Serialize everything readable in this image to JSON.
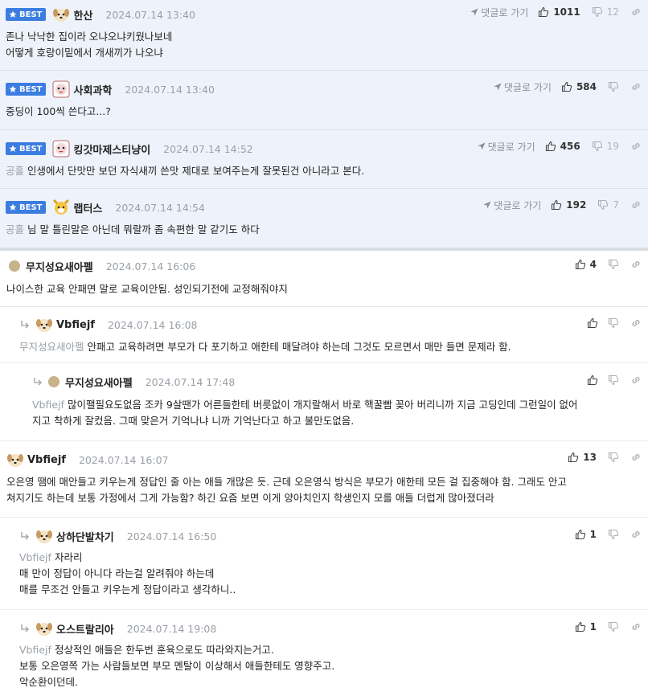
{
  "labels": {
    "best": "BEST",
    "goto": "댓글로 가기"
  },
  "comments": [
    {
      "kind": "best",
      "nick": "한산",
      "date": "2024.07.14 13:40",
      "up": "1011",
      "down": "12",
      "lines": [
        "존나 낙낙한 집이라 오냐오냐키웠나보네",
        "어떻게 호랑이밑에서 개새끼가 나오냐"
      ],
      "mention": ""
    },
    {
      "kind": "best",
      "nick": "사회과학",
      "date": "2024.07.14 13:40",
      "up": "584",
      "down": "",
      "lines": [
        "중딩이 100씩 쓴다고...?"
      ],
      "mention": ""
    },
    {
      "kind": "best",
      "nick": "킹갓마제스티냥이",
      "date": "2024.07.14 14:52",
      "up": "456",
      "down": "19",
      "lines": [
        "인생에서 단맛만 보던 자식새끼 쓴맛 제대로 보여주는게 잘못된건 아니라고 본다."
      ],
      "mention": "공홀"
    },
    {
      "kind": "best",
      "nick": "랩터스",
      "date": "2024.07.14 14:54",
      "up": "192",
      "down": "7",
      "lines": [
        "님 말 틀린말은 아닌데 뭐랄까 좀 속편한 말 같기도 하다"
      ],
      "mention": "공홀"
    },
    {
      "kind": "normal",
      "nick": "무지성요새아펠",
      "date": "2024.07.14 16:06",
      "up": "4",
      "down": "",
      "lines": [
        "나이스한 교육 안패면 말로 교육이안됨. 성인되기전에 교정해줘야지"
      ],
      "mention": ""
    },
    {
      "kind": "reply",
      "nick": "Vbfiejf",
      "date": "2024.07.14 16:08",
      "up": "",
      "down": "",
      "lines": [
        "안패고 교육하려면 부모가 다 포기하고 애한테 매달려야 하는데 그것도 모르면서 매만 들면 문제라 함."
      ],
      "mention": "무지성요새아펠"
    },
    {
      "kind": "reply",
      "nick": "무지성요새아펠",
      "date": "2024.07.14 17:48",
      "up": "",
      "down": "",
      "lines": [
        "많이팰필요도없음 조카 9살땐가 어른들한테 버릇없이 개지랄해서 바로 핵꿀빰 꽂아 버리니까 지금 고딩인데 그런일이 없어",
        "지고 착하게 잘컸음. 그때 맞은거 기억나냐 니까 기억난다고 하고 불만도없음."
      ],
      "mention": "Vbfiejf"
    },
    {
      "kind": "normal",
      "nick": "Vbfiejf",
      "date": "2024.07.14 16:07",
      "up": "13",
      "down": "",
      "lines": [
        "오은영 땜에 매안들고 키우는게 정답인 줄 아는 애들 개많은 듯. 근데 오은영식 방식은 부모가 애한테 모든 걸 집중해야 함. 그래도 안고",
        "쳐지기도 하는데 보통 가정에서 그게 가능함? 하긴 요즘 보면 이게 양아치인지 학생인지 모를 애들 더럽게 많아졌더라"
      ],
      "mention": ""
    },
    {
      "kind": "reply",
      "nick": "상하단발차기",
      "date": "2024.07.14 16:50",
      "up": "1",
      "down": "",
      "lines": [
        "자라리",
        "매 만이 정답이 아니다 라는걸 알려줘야 하는데",
        "매를 무조건 안들고 키우는게 정답이라고 생각하니.."
      ],
      "mention": "Vbfiejf"
    },
    {
      "kind": "reply",
      "nick": "오스트랄리아",
      "date": "2024.07.14 19:08",
      "up": "1",
      "down": "",
      "lines": [
        "정상적인 애들은 한두번 훈육으로도 따라와지는거고.",
        "보통 오은영쪽 가는 사람들보면 부모 멘탈이 이상해서 애들한테도 영향주고.",
        "악순환이던데."
      ],
      "mention": "Vbfiejf"
    }
  ],
  "colors": {
    "best_badge": "#3b7de0",
    "best_bg": "#eef3fb",
    "muted": "#9aa0a6"
  }
}
